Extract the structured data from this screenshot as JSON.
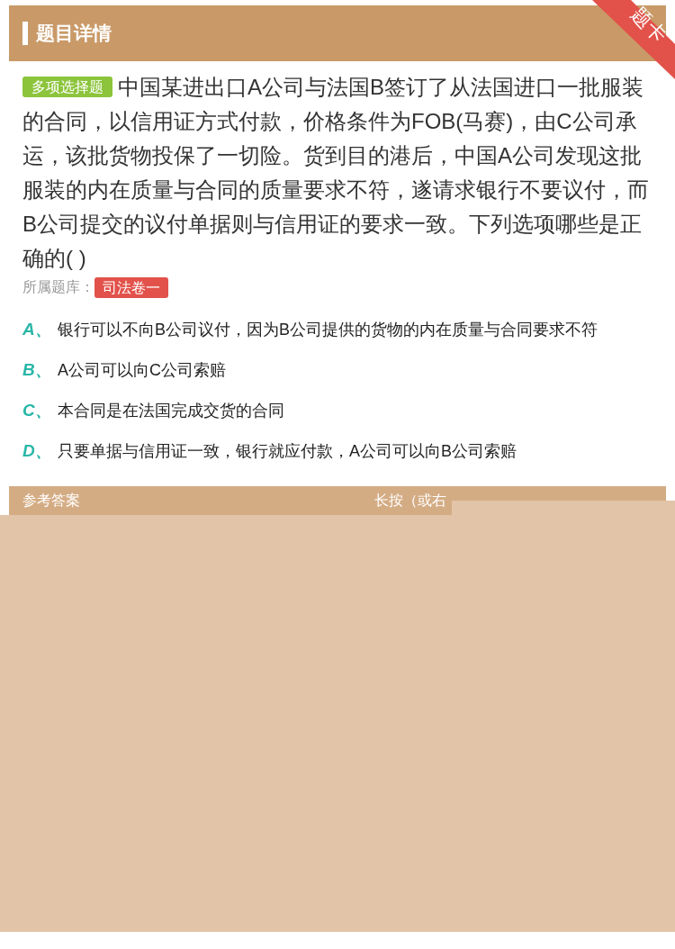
{
  "header": {
    "title": "题目详情",
    "ribbon": "题卡"
  },
  "question": {
    "type_badge": "多项选择题",
    "text": "中国某进出口A公司与法国B签订了从法国进口一批服装的合同，以信用证方式付款，价格条件为FOB(马赛)，由C公司承运，该批货物投保了一切险。货到目的港后，中国A公司发现这批服装的内在质量与合同的质量要求不符，遂请求银行不要议付，而B公司提交的议付单据则与信用证的要求一致。下列选项哪些是正确的( )",
    "bank_label": "所属题库：",
    "bank": "司法卷一"
  },
  "options": [
    {
      "letter": "A、",
      "text": "银行可以不向B公司议付，因为B公司提供的货物的内在质量与合同要求不符"
    },
    {
      "letter": "B、",
      "text": "A公司可以向C公司索赔"
    },
    {
      "letter": "C、",
      "text": "本合同是在法国完成交货的合同"
    },
    {
      "letter": "D、",
      "text": "只要单据与信用证一致，银行就应付款，A公司可以向B公司索赔"
    }
  ],
  "answer_bar": {
    "title": "参考答案",
    "hint": "长按（或右"
  }
}
